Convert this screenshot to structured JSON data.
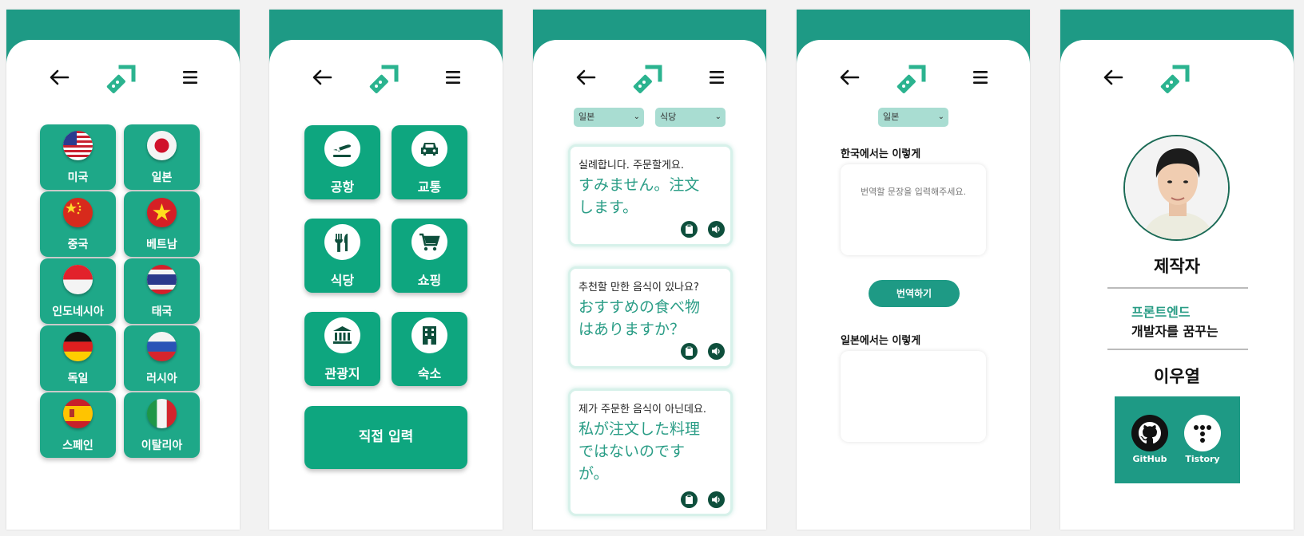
{
  "screen1": {
    "countries": [
      {
        "label": "미국",
        "flag": "us-flag"
      },
      {
        "label": "일본",
        "flag": "japan-flag"
      },
      {
        "label": "중국",
        "flag": "china-flag"
      },
      {
        "label": "베트남",
        "flag": "vietnam-flag"
      },
      {
        "label": "인도네시아",
        "flag": "indonesia-flag"
      },
      {
        "label": "태국",
        "flag": "thailand-flag"
      },
      {
        "label": "독일",
        "flag": "germany-flag"
      },
      {
        "label": "러시아",
        "flag": "russia-flag"
      },
      {
        "label": "스페인",
        "flag": "spain-flag"
      },
      {
        "label": "이탈리아",
        "flag": "italy-flag"
      }
    ]
  },
  "screen2": {
    "categories": [
      {
        "label": "공항",
        "icon": "airplane-icon"
      },
      {
        "label": "교통",
        "icon": "car-icon"
      },
      {
        "label": "식당",
        "icon": "utensils-icon"
      },
      {
        "label": "쇼핑",
        "icon": "cart-icon"
      },
      {
        "label": "관광지",
        "icon": "landmark-icon"
      },
      {
        "label": "숙소",
        "icon": "hotel-icon"
      }
    ],
    "direct_input": "직접 입력"
  },
  "screen3": {
    "country_select": "일본",
    "category_select": "식당",
    "phrases": [
      {
        "ko": "실례합니다. 주문할게요.",
        "ja": "すみません。注文します。"
      },
      {
        "ko": "추천할 만한 음식이 있나요?",
        "ja": "おすすめの食べ物はありますか？"
      },
      {
        "ko": "제가 주문한 음식이 아닌데요.",
        "ja": "私が注文した料理ではないのですが。"
      }
    ]
  },
  "screen4": {
    "country_select": "일본",
    "input_label": "한국에서는 이렇게",
    "input_placeholder": "번역할 문장을 입력해주세요.",
    "translate_button": "번역하기",
    "output_label": "일본에서는 이렇게",
    "output_value": ""
  },
  "screen5": {
    "title": "제작자",
    "role_highlight": "프론트엔드",
    "role_desc": "개발자를 꿈꾸는",
    "name": "이우열",
    "links": [
      {
        "label": "GitHub",
        "icon": "github-icon"
      },
      {
        "label": "Tistory",
        "icon": "tistory-icon"
      }
    ]
  },
  "colors": {
    "header": "#1e9a85",
    "button": "#0ea67f",
    "accent_text": "#2a9d86",
    "icon_dark": "#0e4f3c"
  }
}
